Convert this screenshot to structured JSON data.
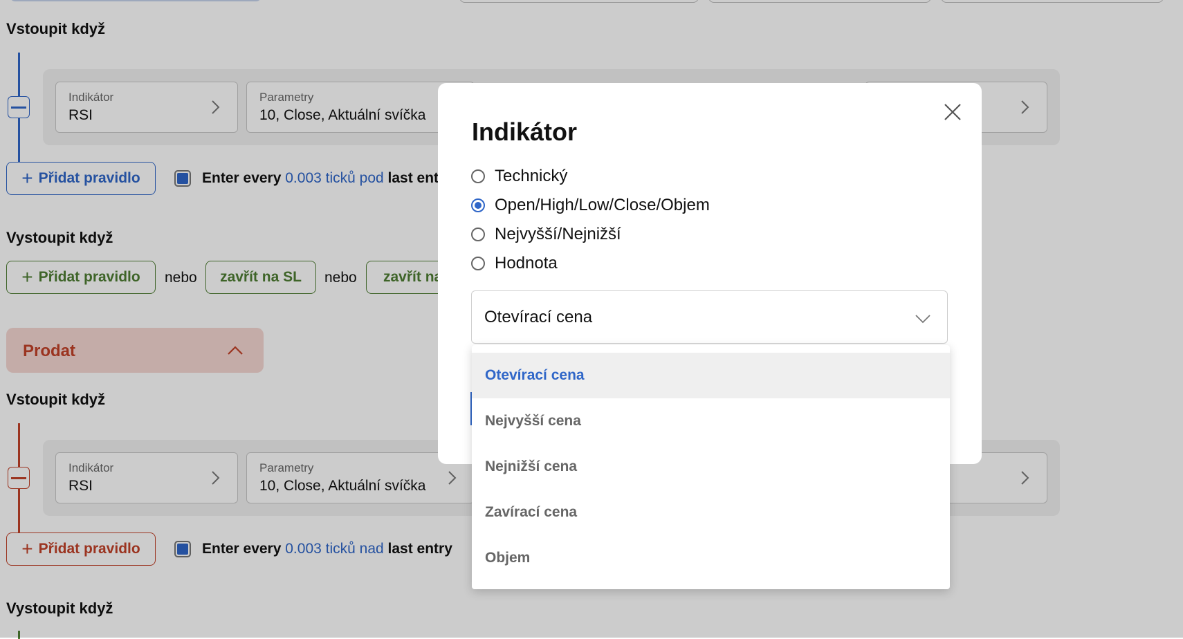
{
  "colors": {
    "accent_blue": "#2f66c8",
    "green": "#4e7d33",
    "red": "#c24129",
    "sell_bg": "#f5d8d2"
  },
  "buy_section": {
    "enter_title": "Vstoupit když",
    "rule": {
      "indicator_label": "Indikátor",
      "indicator_value": "RSI",
      "params_label": "Parametry",
      "params_value": "10, Close, Aktuální svíčka"
    },
    "add_rule": "Přidat pravidlo",
    "enter_every": {
      "prefix": "Enter every ",
      "highlight": "0.003 ticků pod",
      "suffix": " last entry"
    },
    "exit_title": "Vystoupit když",
    "exit_add_rule": "Přidat pravidlo",
    "or_word": "nebo",
    "close_sl": "zavřít na SL",
    "close_tp_partial": "zavřít na"
  },
  "sell_section": {
    "header": "Prodat",
    "enter_title": "Vstoupit když",
    "rule": {
      "indicator_label": "Indikátor",
      "indicator_value": "RSI",
      "params_label": "Parametry",
      "params_value": "10, Close, Aktuální svíčka"
    },
    "add_rule": "Přidat pravidlo",
    "enter_every": {
      "prefix": "Enter every ",
      "highlight": "0.003 ticků nad",
      "suffix": " last entry"
    },
    "exit_title": "Vystoupit když"
  },
  "modal": {
    "title": "Indikátor",
    "options": [
      {
        "label": "Technický",
        "checked": false
      },
      {
        "label": "Open/High/Low/Close/Objem",
        "checked": true
      },
      {
        "label": "Nejvyšší/Nejnižší",
        "checked": false
      },
      {
        "label": "Hodnota",
        "checked": false
      }
    ],
    "select_value": "Otevírací cena",
    "dropdown_options": [
      "Otevírací cena",
      "Nejvyšší cena",
      "Nejnižší cena",
      "Zavírací cena",
      "Objem"
    ],
    "selected_index": 0
  }
}
